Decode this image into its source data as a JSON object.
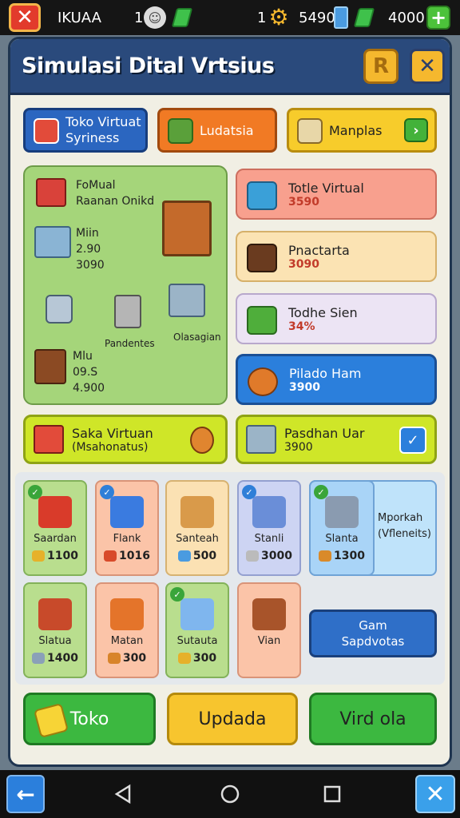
{
  "topbar": {
    "title": "IKUAA",
    "count_1": "1",
    "count_2": "1",
    "coins": "5490",
    "gems": "4000",
    "plus": "+"
  },
  "header": {
    "title": "Simulasi Dital Vrtsius",
    "r_label": "R",
    "close_label": "✕"
  },
  "tabs": [
    {
      "label_line1": "Toko Virtuat",
      "label_line2": "Syriness"
    },
    {
      "label_line1": "Ludatsia",
      "label_line2": ""
    },
    {
      "label_line1": "Manplas",
      "label_line2": ""
    }
  ],
  "green_area": {
    "title_line1": "FoMual",
    "title_line2": "Raanan Onikd",
    "item1_name": "Miin",
    "item1_val1": "2.90",
    "item1_val2": "3090",
    "item2_name": "Pandentes",
    "item3_name": "Olasagian",
    "item4_name": "Mlu",
    "item4_val1": "09.S",
    "item4_val2": "4.900"
  },
  "side_cards": [
    {
      "title": "Totle Virtual",
      "value": "3590"
    },
    {
      "title": "Pnactarta",
      "value": "3090"
    },
    {
      "title": "Todhe Sien",
      "value": "34%"
    },
    {
      "title": "Pilado Ham",
      "value": "3900"
    }
  ],
  "banners": [
    {
      "title": "Saka Virtuan",
      "sub": "(Msahonatus)"
    },
    {
      "title": "Pasdhan Uar",
      "sub": "3900"
    }
  ],
  "tiles": [
    {
      "label": "Saardan",
      "price": "1100"
    },
    {
      "label": "Flank",
      "price": "1016"
    },
    {
      "label": "Santeah",
      "price": "500"
    },
    {
      "label": "Stanli",
      "price": "3000"
    },
    {
      "label": "Slanta",
      "price": "1300"
    },
    {
      "label": "Slatua",
      "price": "1400"
    },
    {
      "label": "Matan",
      "price": "300"
    },
    {
      "label": "Sutauta",
      "price": "300"
    },
    {
      "label": "Vian",
      "price": ""
    }
  ],
  "wide_tile": {
    "line1": "Mporkah",
    "line2": "(Vfleneits)"
  },
  "action_button": {
    "line1": "Gam",
    "line2": "Sapdvotas"
  },
  "bottom_buttons": {
    "b1": "Toko",
    "b2": "Updada",
    "b3": "Vird ola"
  },
  "colors": {
    "primary": "#2a4a7c",
    "accent": "#f7c52e",
    "success": "#3cb840"
  }
}
